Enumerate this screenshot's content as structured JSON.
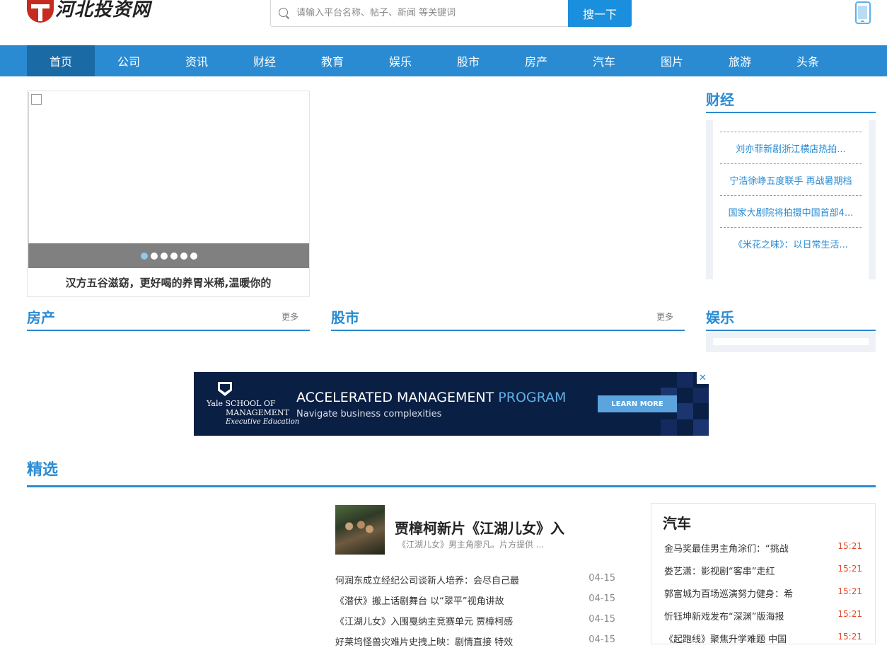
{
  "header": {
    "logo_text": "河北投资网",
    "search_placeholder": "请输入平台名称、帖子、新闻 等关键词",
    "search_button": "搜一下"
  },
  "nav": {
    "items": [
      "首页",
      "公司",
      "资讯",
      "财经",
      "教育",
      "娱乐",
      "股市",
      "房产",
      "汽车",
      "图片",
      "旅游",
      "头条"
    ],
    "active_index": 0
  },
  "slider": {
    "caption": "汉方五谷滋窈，更好喝的养胃米稀,温暖你的",
    "dot_count": 6,
    "active_dot": 0
  },
  "finance": {
    "title": "财经",
    "items": [
      "刘亦菲新剧浙江横店热拍...",
      "宁浩徐峥五度联手 再战暑期档",
      "国家大剧院将拍摄中国首部4...",
      "《米花之味》：以日常生活..."
    ]
  },
  "sections": {
    "realestate_title": "房产",
    "realestate_more": "更多",
    "stock_title": "股市",
    "stock_more": "更多",
    "entertainment_title": "娱乐"
  },
  "ad": {
    "school_line1": "Yale SCHOOL OF",
    "school_line2": "MANAGEMENT",
    "school_line3": "Executive Education",
    "headline_main": "ACCELERATED MANAGEMENT ",
    "headline_highlight": "PROGRAM",
    "subline": "Navigate business complexities",
    "button": "LEARN MORE",
    "close": "✕"
  },
  "featured": {
    "title": "精选",
    "headline": "贾樟柯新片《江湖儿女》入",
    "summary": "《江湖儿女》男主角廖凡。片方提供 ...",
    "news": [
      {
        "title": "何润东成立经纪公司谈新人培养：会尽自己最",
        "date": "04-15"
      },
      {
        "title": "《潜伏》搬上话剧舞台 以“翠平”视角讲故",
        "date": "04-15"
      },
      {
        "title": "《江湖儿女》入围戛纳主竞赛单元 贾樟柯感",
        "date": "04-15"
      },
      {
        "title": "好莱坞怪兽灾难片史拽上映：剧情直接 特效",
        "date": "04-15"
      }
    ]
  },
  "auto": {
    "title": "汽车",
    "items": [
      {
        "title": "金马奖最佳男主角涂们：“挑战",
        "time": "15:21"
      },
      {
        "title": "娄艺潇：影视剧“客串”走红",
        "time": "15:21"
      },
      {
        "title": "郭富城为百场巡演努力健身：希",
        "time": "15:21"
      },
      {
        "title": "忻钰坤新戏发布“深渊”版海报",
        "time": "15:21"
      },
      {
        "title": "《起跑线》聚焦升学难题 中国",
        "time": "15:21"
      }
    ]
  }
}
